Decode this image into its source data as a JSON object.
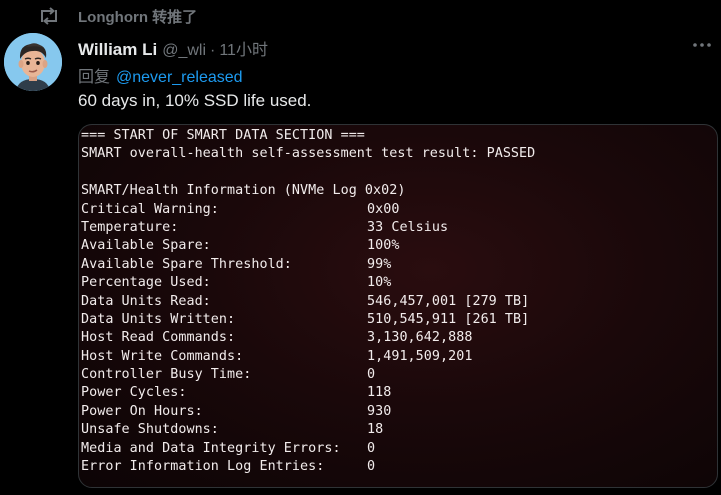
{
  "retweet": {
    "label": "Longhorn 转推了"
  },
  "author": {
    "name": "William Li",
    "handle": "@_wli",
    "separator": "·",
    "time": "11小时"
  },
  "reply": {
    "prefix": "回复",
    "handle": "@never_released"
  },
  "tweet": {
    "text": "60 days in, 10% SSD life used."
  },
  "terminal": {
    "header": "=== START OF SMART DATA SECTION ===",
    "health": "SMART overall-health self-assessment test result: PASSED",
    "blank": "",
    "section_title": "SMART/Health Information (NVMe Log 0x02)",
    "rows": [
      {
        "key": "Critical Warning:",
        "value": "0x00"
      },
      {
        "key": "Temperature:",
        "value": "33 Celsius"
      },
      {
        "key": "Available Spare:",
        "value": "100%"
      },
      {
        "key": "Available Spare Threshold:",
        "value": "99%"
      },
      {
        "key": "Percentage Used:",
        "value": "10%"
      },
      {
        "key": "Data Units Read:",
        "value": "546,457,001 [279 TB]"
      },
      {
        "key": "Data Units Written:",
        "value": "510,545,911 [261 TB]"
      },
      {
        "key": "Host Read Commands:",
        "value": "3,130,642,888"
      },
      {
        "key": "Host Write Commands:",
        "value": "1,491,509,201"
      },
      {
        "key": "Controller Busy Time:",
        "value": "0"
      },
      {
        "key": "Power Cycles:",
        "value": "118"
      },
      {
        "key": "Power On Hours:",
        "value": "930"
      },
      {
        "key": "Unsafe Shutdowns:",
        "value": "18"
      },
      {
        "key": "Media and Data Integrity Errors:",
        "value": "0"
      },
      {
        "key": "Error Information Log Entries:",
        "value": "0"
      }
    ]
  },
  "icons": {
    "retweet": "retweet-icon",
    "more": "more-dots-icon",
    "avatar": "memoji-avatar"
  },
  "colors": {
    "background": "#000000",
    "primary_text": "#e7e9ea",
    "secondary_text": "#71767b",
    "link": "#1d9bf0",
    "terminal_bg": "#1a080a"
  }
}
